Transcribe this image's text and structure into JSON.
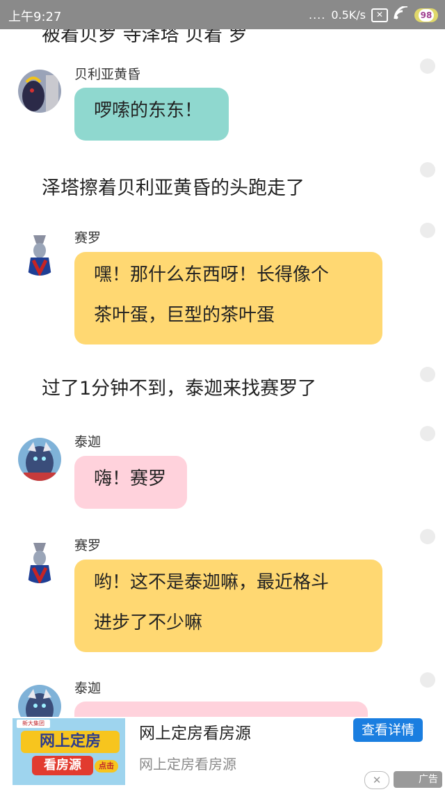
{
  "status_bar": {
    "time": "上午9:27",
    "signal_dots": "....",
    "network_speed": "0.5K/s",
    "battery_level": "98"
  },
  "chat": {
    "cut_top_text": "被着贝罗 寺泽塔 贝着 罗",
    "messages": [
      {
        "type": "chat",
        "name": "贝利亚黄昏",
        "text": "啰嗦的东东！",
        "color": "#8fd8cf"
      },
      {
        "type": "narration",
        "text": "泽塔擦着贝利亚黄昏的头跑走了"
      },
      {
        "type": "chat",
        "name": "赛罗",
        "lines": [
          "嘿！那什么东西呀！长得像个",
          "茶叶蛋，巨型的茶叶蛋"
        ],
        "color": "#ffd872"
      },
      {
        "type": "narration",
        "text": "过了1分钟不到，泰迦来找赛罗了"
      },
      {
        "type": "chat",
        "name": "泰迦",
        "text": "嗨！赛罗",
        "color": "#ffd2dc"
      },
      {
        "type": "chat",
        "name": "赛罗",
        "lines": [
          "哟！这不是泰迦嘛，最近格斗",
          "进步了不少嘛"
        ],
        "color": "#ffd872"
      },
      {
        "type": "chat",
        "name": "泰迦",
        "text": "",
        "color": "#ffd2dc"
      }
    ]
  },
  "ad": {
    "title": "网上定房看房源",
    "subtitle": "网上定房看房源",
    "button_label": "查看详情",
    "image_line1": "网上定房",
    "image_line2": "看房源",
    "image_tag": "点击",
    "image_logo": "新大集团",
    "close_symbol": "✕",
    "badge": "广告"
  }
}
